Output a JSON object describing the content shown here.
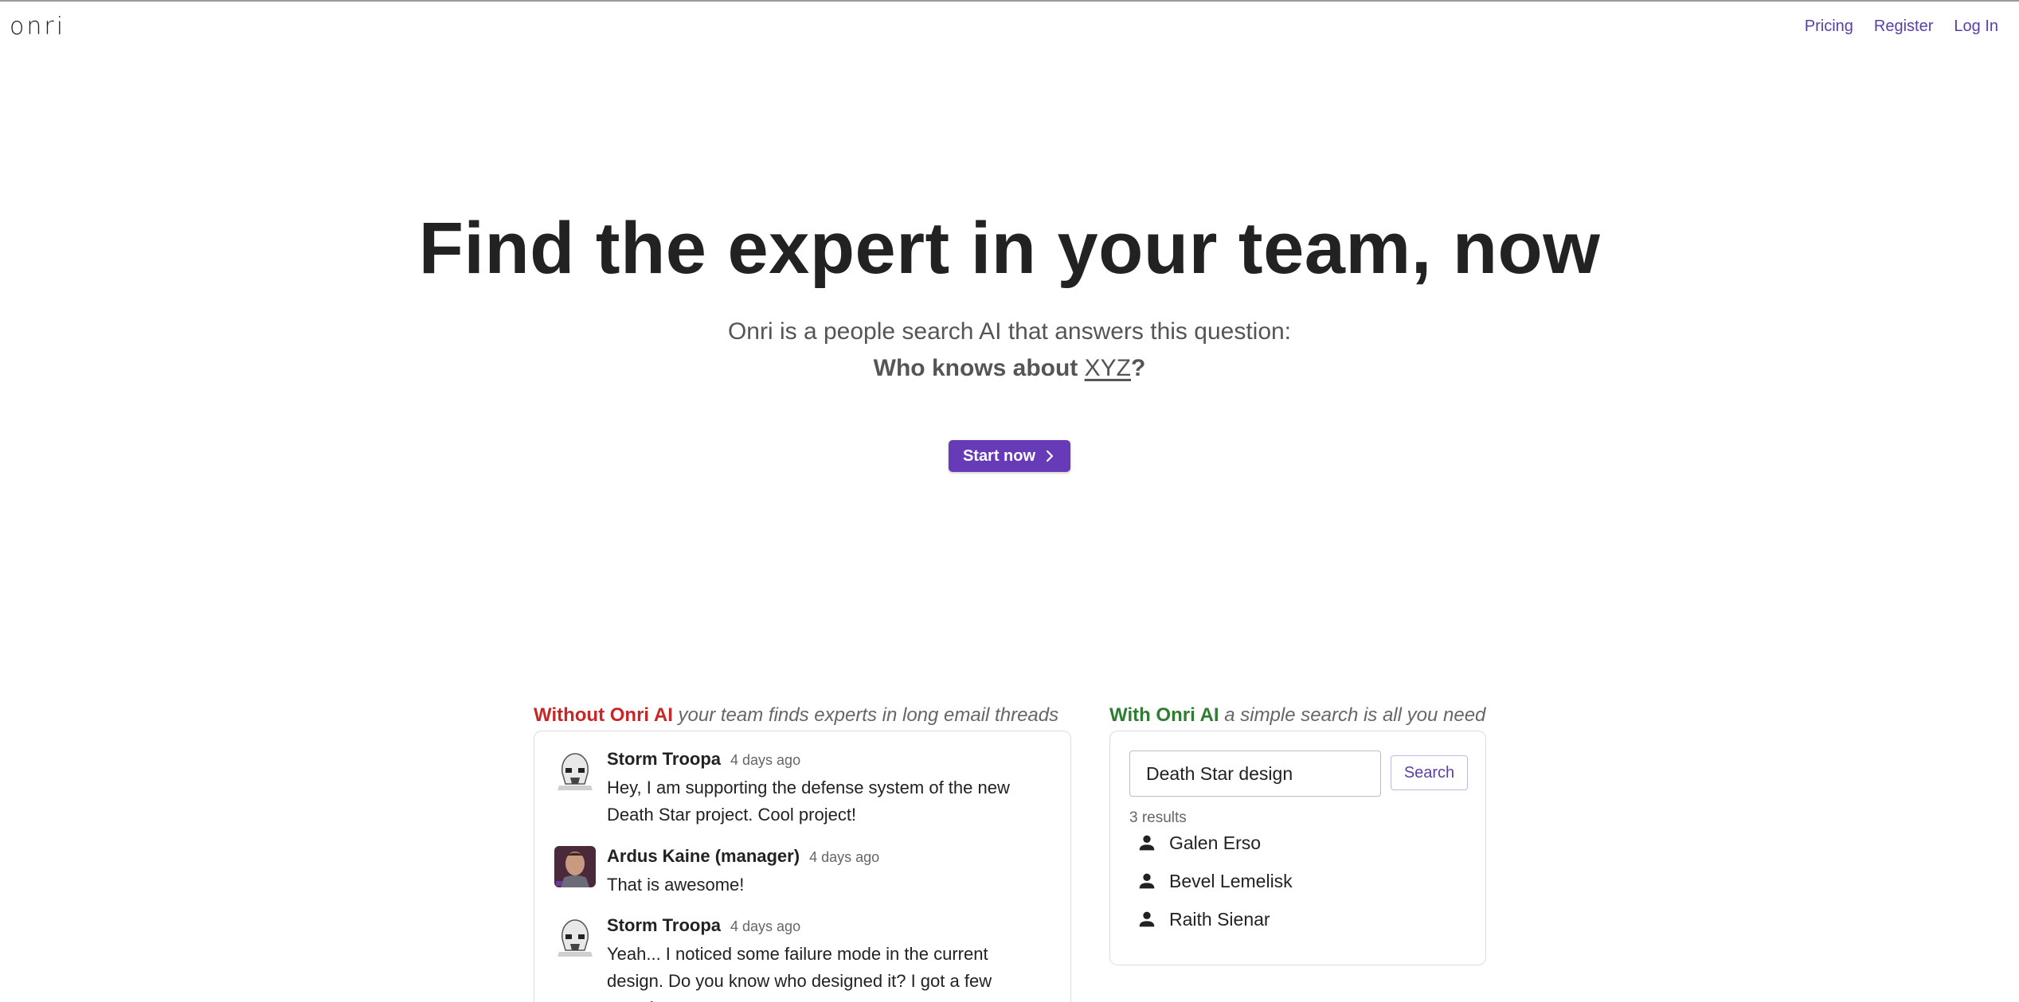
{
  "header": {
    "logo": "onri",
    "nav": [
      "Pricing",
      "Register",
      "Log In"
    ]
  },
  "hero": {
    "title": "Find the expert in your team, now",
    "subtitle": "Onri is a people search AI that answers this question:",
    "question_prefix": "Who knows about ",
    "question_term": "XYZ",
    "question_suffix": "?",
    "cta_label": "Start now"
  },
  "without": {
    "label": "Without Onri AI",
    "description": "your team finds experts in long email threads",
    "messages": [
      {
        "author": "Storm Troopa",
        "time": "4 days ago",
        "text": "Hey, I am supporting the defense system of the new Death Star project. Cool project!",
        "avatar": "stormtrooper-avatar"
      },
      {
        "author": "Ardus Kaine (manager)",
        "time": "4 days ago",
        "text": "That is awesome!",
        "avatar": "manager-avatar"
      },
      {
        "author": "Storm Troopa",
        "time": "4 days ago",
        "text": "Yeah... I noticed some failure mode in the current design. Do you know who designed it? I got a few questions",
        "avatar": "stormtrooper-avatar"
      }
    ]
  },
  "with": {
    "label": "With Onri AI",
    "description": "a simple search is all you need",
    "search_value": "Death Star design",
    "search_button": "Search",
    "results_count": "3 results",
    "results": [
      "Galen Erso",
      "Bevel Lemelisk",
      "Raith Sienar"
    ]
  },
  "colors": {
    "accent": "#673ab7",
    "nav_link": "#5b3fa8",
    "negative": "#c62828",
    "positive": "#2e7d32"
  }
}
